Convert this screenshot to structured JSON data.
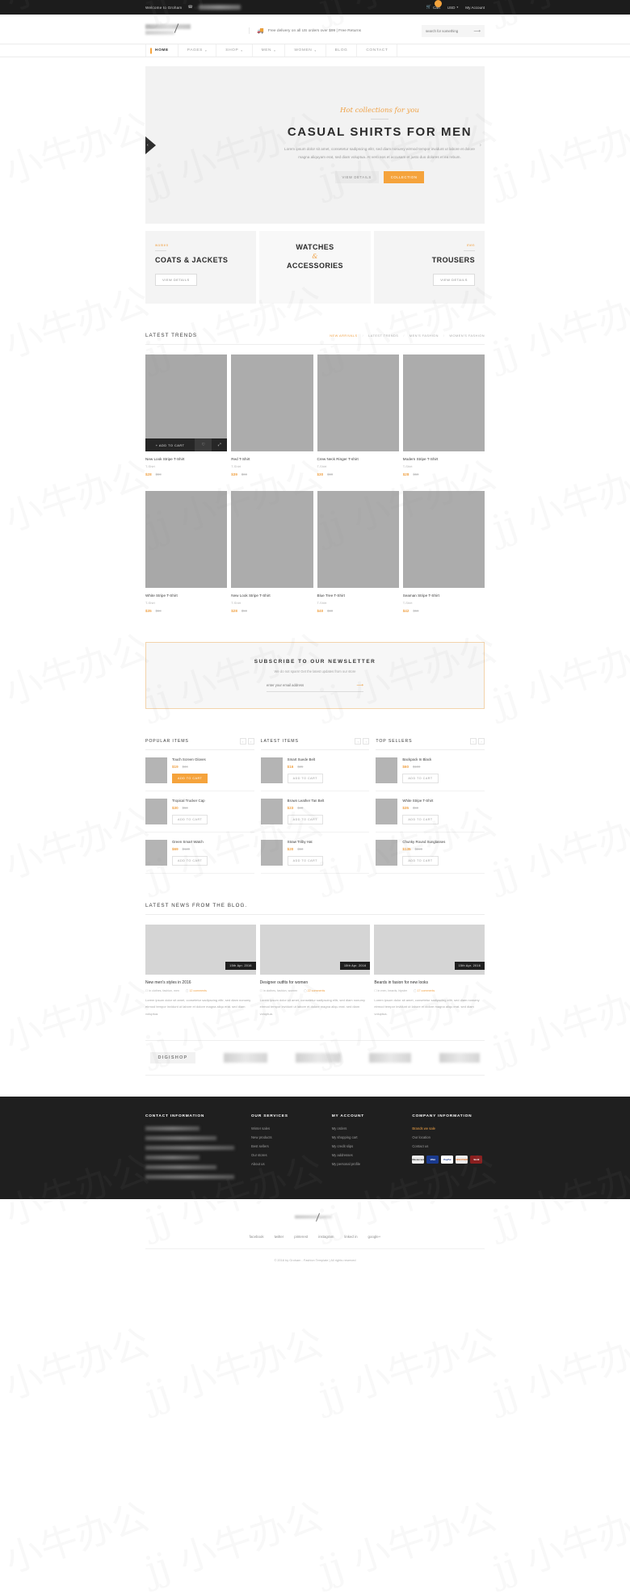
{
  "topbar": {
    "welcome": "Welcome to Groham",
    "phone_icon": "phone-icon",
    "cart_label": "Cart",
    "cart_icon": "cart-icon",
    "currency": "USD",
    "account": "My Account"
  },
  "header": {
    "delivery_icon": "truck-icon",
    "delivery_text": "Free delivery on all US orders over $99 | Free Returns",
    "search_placeholder": "search for something",
    "search_value": "",
    "search_icon": "arrow-right-icon"
  },
  "nav": {
    "items": [
      {
        "label": "HOME",
        "caret": ""
      },
      {
        "label": "PAGES",
        "caret": "▾"
      },
      {
        "label": "SHOP",
        "caret": "▾"
      },
      {
        "label": "MEN",
        "caret": "▾"
      },
      {
        "label": "WOMEN",
        "caret": "▾"
      },
      {
        "label": "BLOG",
        "caret": ""
      },
      {
        "label": "CONTACT",
        "caret": ""
      }
    ]
  },
  "hero": {
    "kicker": "Hot collections for you",
    "title": "CASUAL SHIRTS FOR MEN",
    "paragraph": "Lorem ipsum dolor sit amet, consetetur sadipscing elitr, sed diam nonumy eirmod tempor invidunt ut labore et dolore magna aliquyam erat, sed diam voluptua. At vero eos et accusam et justo duo dolores et ea rebum.",
    "btn_details": "VIEW DETAILS",
    "btn_collection": "COLLECTION",
    "prev_icon": "chevron-left-icon",
    "next_icon": "chevron-right-icon"
  },
  "categories": [
    {
      "kicker": "women",
      "title": "COATS & JACKETS",
      "button": "VIEW DETAILS"
    },
    {
      "kicker": "",
      "title_top": "WATCHES",
      "amp": "&",
      "title_bottom": "ACCESSORIES",
      "button": ""
    },
    {
      "kicker": "men",
      "title": "TROUSERS",
      "button": "VIEW DETAILS"
    }
  ],
  "latest_trends": {
    "title": "LATEST TRENDS",
    "filters": [
      "NEW ARRIVALS",
      "LATEST TRENDS",
      "MEN'S FASHION",
      "WOMEN'S FASHION"
    ],
    "active_filter": "NEW ARRIVALS",
    "hover": {
      "add_to_cart": "+ ADD TO CART",
      "wishlist_icon": "heart-icon",
      "zoom_icon": "expand-icon"
    },
    "products": [
      {
        "name": "New Look Stripe T-Shirt",
        "category": "T-Shirt",
        "price": "$28",
        "old": "$59"
      },
      {
        "name": "Red T-Shirt",
        "category": "T-Shirt",
        "price": "$39",
        "old": "$69"
      },
      {
        "name": "Crew Neck Ringer T-shirt",
        "category": "T-Shirt",
        "price": "$30",
        "old": "$69"
      },
      {
        "name": "Modern Stripe T-Shirt",
        "category": "T-Shirt",
        "price": "$28",
        "old": "$59"
      },
      {
        "name": "White Stripe T-Shirt",
        "category": "T-Shirt",
        "price": "$35",
        "old": "$59"
      },
      {
        "name": "New Look Stripe T-Shirt",
        "category": "T-Shirt",
        "price": "$28",
        "old": "$59"
      },
      {
        "name": "Blue Tree T-Shirt",
        "category": "T-Shirt",
        "price": "$40",
        "old": "$69"
      },
      {
        "name": "Seaman Stripe T-Shirt",
        "category": "T-Shirt",
        "price": "$42",
        "old": "$59"
      }
    ]
  },
  "newsletter": {
    "title": "SUBSCRIBE TO OUR NEWSLETTER",
    "subtitle": "We do not spam! Get the latest updates from our store",
    "placeholder": "enter your email address",
    "value": "",
    "submit_icon": "arrow-right-icon"
  },
  "lists": [
    {
      "title": "POPULAR ITEMS",
      "prev_icon": "chevron-left-icon",
      "next_icon": "chevron-right-icon",
      "items": [
        {
          "name": "Touch Screen Gloves",
          "price": "$19",
          "old": "$34",
          "button": "ADD TO CART",
          "highlight": true
        },
        {
          "name": "Tropical Trucker Cap",
          "price": "$30",
          "old": "$50",
          "button": "ADD TO CART",
          "highlight": false
        },
        {
          "name": "Green Smart Watch",
          "price": "$69",
          "old": "$120",
          "button": "ADD TO CART",
          "highlight": false
        }
      ]
    },
    {
      "title": "LATEST ITEMS",
      "prev_icon": "chevron-left-icon",
      "next_icon": "chevron-right-icon",
      "items": [
        {
          "name": "Smart Suede Belt",
          "price": "$16",
          "old": "$25",
          "button": "ADD TO CART",
          "highlight": false
        },
        {
          "name": "Brown Leather Tan Belt",
          "price": "$23",
          "old": "$40",
          "button": "ADD TO CART",
          "highlight": false
        },
        {
          "name": "Straw Trilby Hat",
          "price": "$20",
          "old": "$50",
          "button": "ADD TO CART",
          "highlight": false
        }
      ]
    },
    {
      "title": "TOP SELLERS",
      "prev_icon": "chevron-left-icon",
      "next_icon": "chevron-right-icon",
      "items": [
        {
          "name": "Backpack In Black",
          "price": "$60",
          "old": "$100",
          "button": "ADD TO CART",
          "highlight": false
        },
        {
          "name": "White Stripe T-Shirt",
          "price": "$35",
          "old": "$59",
          "button": "ADD TO CART",
          "highlight": false
        },
        {
          "name": "Chunky Round Sunglasses",
          "price": "$135",
          "old": "$220",
          "button": "ADD TO CART",
          "highlight": false
        }
      ]
    }
  ],
  "blog": {
    "title": "LATEST NEWS FROM THE BLOG.",
    "posts": [
      {
        "date": "15th Apr. 2016",
        "title": "New men's styles in 2016",
        "tags": "in clothes, fashion, men",
        "comments": "12 comments",
        "excerpt": "Lorem ipsum dolor sit amet, consetetur sadipscing elitr, sed diam nonumy eirmod tempor invidunt ut labore et dolore magna aliqu erat. sed diam voluptua."
      },
      {
        "date": "15th Apr. 2016",
        "title": "Designer outfits for women",
        "tags": "in clothes, fashion, women",
        "comments": "22 comments",
        "excerpt": "Lorem ipsum dolor sit amet, consetetur sadipscing elitr, sed diam nonumy eirmod tempor invidunt ut labore et dolore magna aliqu erat. sed diam voluptua."
      },
      {
        "date": "15th Apr. 2016",
        "title": "Beards in fasion for new looks",
        "tags": "in men, beards, hipster",
        "comments": "17 comments",
        "excerpt": "Lorem ipsum dolor sit amet, consetetur sadipscing elitr, sed diam nonumy eirmod tempor invidunt ut labore et dolore magna aliqu erat. sed diam voluptua."
      }
    ]
  },
  "brands": {
    "first": "DIGISHOP"
  },
  "footer": {
    "columns": [
      {
        "title": "CONTACT INFORMATION",
        "blurred_lines": 6,
        "links": []
      },
      {
        "title": "OUR SERVICES",
        "links": [
          {
            "label": "Winter sales",
            "highlight": false
          },
          {
            "label": "New products",
            "highlight": false
          },
          {
            "label": "Best sellers",
            "highlight": false
          },
          {
            "label": "Our stores",
            "highlight": false
          },
          {
            "label": "About us",
            "highlight": false
          }
        ]
      },
      {
        "title": "MY ACCOUNT",
        "links": [
          {
            "label": "My orders",
            "highlight": false
          },
          {
            "label": "My shopping cart",
            "highlight": false
          },
          {
            "label": "My credit slips",
            "highlight": false
          },
          {
            "label": "My addresses",
            "highlight": false
          },
          {
            "label": "My personal profile",
            "highlight": false
          }
        ]
      },
      {
        "title": "COMPANY INFORMATION",
        "links": [
          {
            "label": "Brands we sale",
            "highlight": true
          },
          {
            "label": "Our location",
            "highlight": false
          },
          {
            "label": "Contact us",
            "highlight": false
          }
        ]
      }
    ],
    "payments": [
      {
        "name": "Mastercard",
        "label": "Mastercard",
        "color": "#ececec",
        "text": "#333"
      },
      {
        "name": "Visa",
        "label": "VISA",
        "color": "#1a3a8f",
        "text": "#fff"
      },
      {
        "name": "PayPal",
        "label": "PayPal",
        "color": "#ffffff",
        "text": "#1a3a8f"
      },
      {
        "name": "Discover",
        "label": "DISCOVER",
        "color": "#ececec",
        "text": "#e06a1e"
      },
      {
        "name": "Skrill",
        "label": "Skrill",
        "color": "#8a1f1f",
        "text": "#fff"
      }
    ]
  },
  "bottom": {
    "socials": [
      "facebook",
      "twitter",
      "pinterest",
      "instagram",
      "linked in",
      "google+"
    ],
    "copyright_prefix": "© 2016 by Groham - Fashion Template | All rights reserved",
    "brand": "Groham"
  }
}
